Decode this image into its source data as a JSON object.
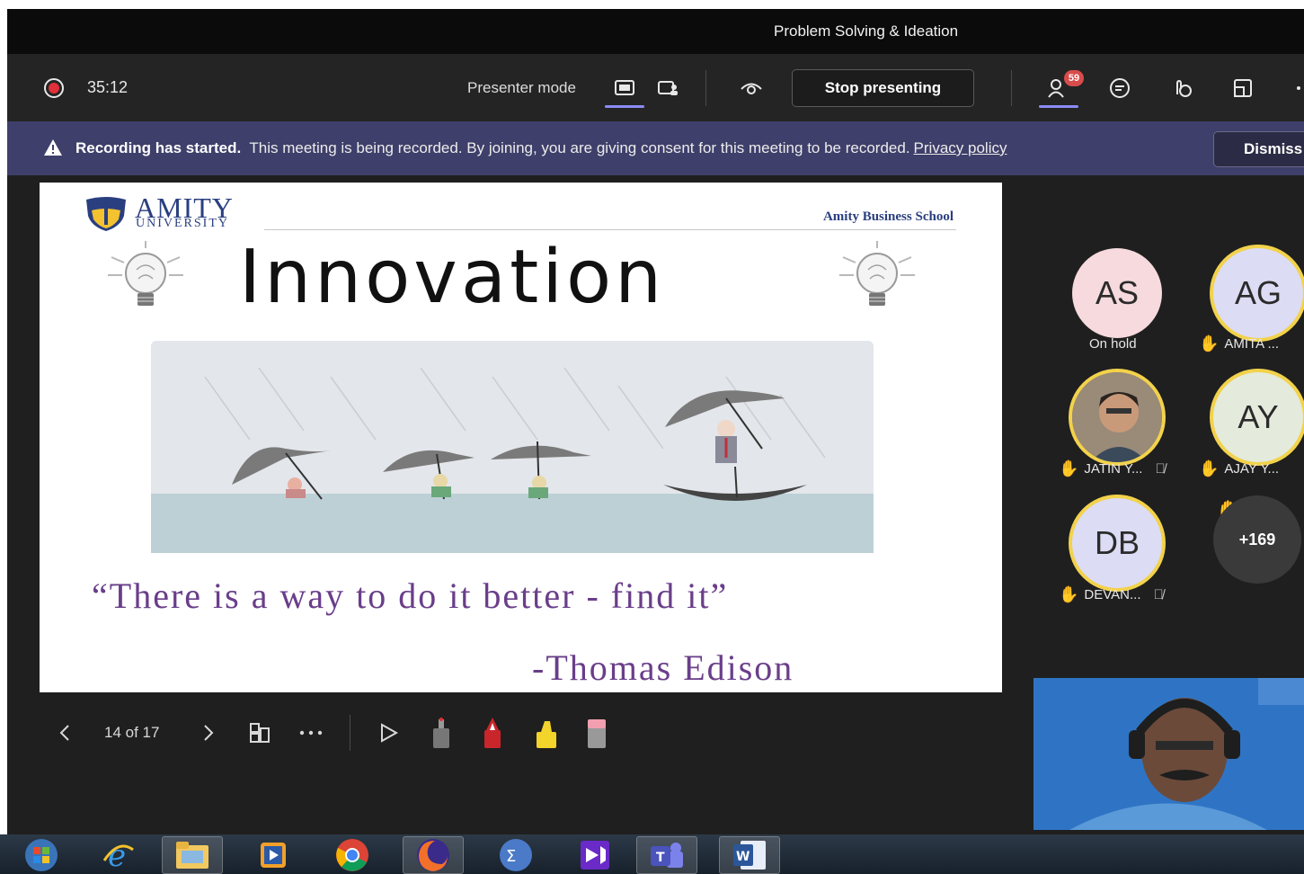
{
  "window": {
    "title": "Problem Solving & Ideation"
  },
  "toolbar": {
    "recording_time": "35:12",
    "presenter_mode_label": "Presenter mode",
    "stop_presenting_label": "Stop presenting",
    "participant_badge": "59"
  },
  "banner": {
    "title": "Recording has started.",
    "message": "This meeting is being recorded. By joining, you are giving consent for this meeting to be recorded.",
    "link": "Privacy policy",
    "dismiss_label": "Dismiss"
  },
  "slide": {
    "logo_name": "AMITY",
    "logo_sub": "UNIVERSITY",
    "school": "Amity Business School",
    "title": "Innovation",
    "quote": "“There is a way to do it better - find it”",
    "author": "-Thomas Edison"
  },
  "slide_controls": {
    "page": "14 of 17"
  },
  "participants": [
    {
      "initials": "AS",
      "label": "On hold",
      "color": "#f6dadd",
      "ring": false,
      "hand": false,
      "muted": false
    },
    {
      "initials": "AG",
      "label": "AMITA ...",
      "color": "#dcdcf5",
      "ring": true,
      "hand": true,
      "muted": false
    },
    {
      "initials": "",
      "label": "JATIN Y...",
      "photo": true,
      "ring": true,
      "hand": true,
      "muted": true
    },
    {
      "initials": "AY",
      "label": "AJAY Y...",
      "color": "#e4eadc",
      "ring": true,
      "hand": true,
      "muted": false
    },
    {
      "initials": "DB",
      "label": "DEVAN...",
      "color": "#dcdcf5",
      "ring": true,
      "hand": true,
      "muted": true
    }
  ],
  "overflow": {
    "label": "+169"
  },
  "colors": {
    "accent": "#8b8cf7",
    "banner": "#3e3f6a",
    "raised_hand": "#f2b93b",
    "record": "#e0303a"
  },
  "taskbar": {
    "apps": [
      "windows-start",
      "internet-explorer",
      "file-explorer",
      "media-player",
      "chrome",
      "firefox",
      "math-app",
      "visual-studio",
      "teams",
      "word"
    ]
  }
}
